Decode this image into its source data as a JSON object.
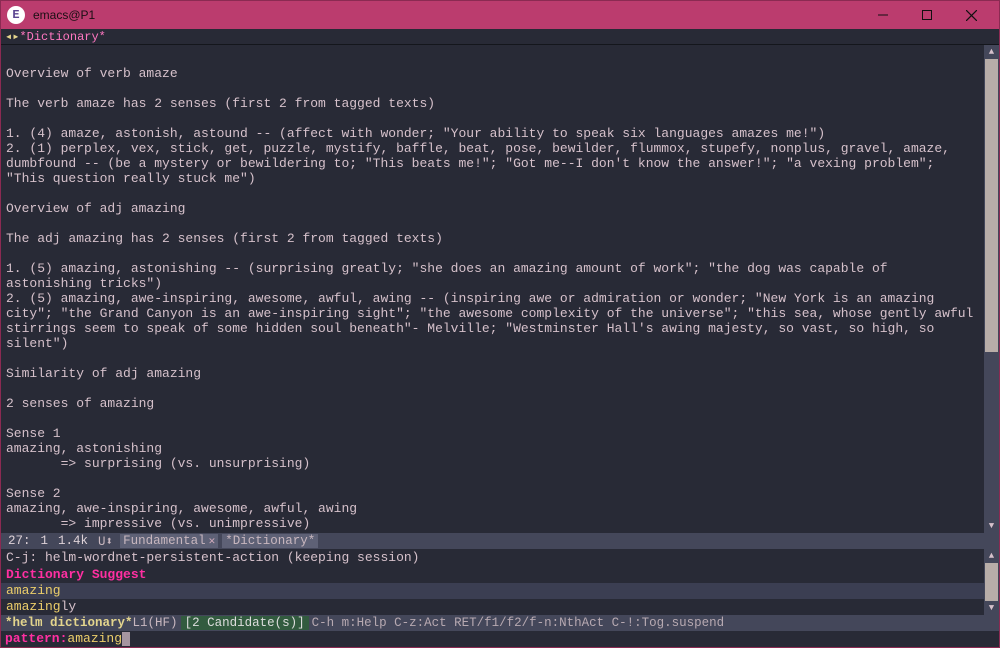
{
  "window": {
    "title": "emacs@P1"
  },
  "buffer_tab": {
    "marker": "◂▸",
    "name": "*Dictionary*"
  },
  "dictionary_text": "\nOverview of verb amaze\n\nThe verb amaze has 2 senses (first 2 from tagged texts)\n\n1. (4) amaze, astonish, astound -- (affect with wonder; \"Your ability to speak six languages amazes me!\")\n2. (1) perplex, vex, stick, get, puzzle, mystify, baffle, beat, pose, bewilder, flummox, stupefy, nonplus, gravel, amaze, dumbfound -- (be a mystery or bewildering to; \"This beats me!\"; \"Got me--I don't know the answer!\"; \"a vexing problem\"; \"This question really stuck me\")\n\nOverview of adj amazing\n\nThe adj amazing has 2 senses (first 2 from tagged texts)\n\n1. (5) amazing, astonishing -- (surprising greatly; \"she does an amazing amount of work\"; \"the dog was capable of astonishing tricks\")\n2. (5) amazing, awe-inspiring, awesome, awful, awing -- (inspiring awe or admiration or wonder; \"New York is an amazing city\"; \"the Grand Canyon is an awe-inspiring sight\"; \"the awesome complexity of the universe\"; \"this sea, whose gently awful stirrings seem to speak of some hidden soul beneath\"- Melville; \"Westminster Hall's awing majesty, so vast, so high, so silent\")\n\nSimilarity of adj amazing\n\n2 senses of amazing\n\nSense 1\namazing, astonishing\n       => surprising (vs. unsurprising)\n\nSense 2\namazing, awe-inspiring, awesome, awful, awing\n       => impressive (vs. unimpressive)\n",
  "modeline1": {
    "line": "27:",
    "col": "1",
    "size": "1.4k",
    "flag": "U⬍",
    "mode": "Fundamental",
    "buffer": "*Dictionary*"
  },
  "helm": {
    "action_hint": "C-j: helm-wordnet-persistent-action (keeping session)",
    "header": "Dictionary Suggest",
    "candidates": [
      {
        "match": "amazing",
        "rest": ""
      },
      {
        "match": "amazing",
        "rest": "ly"
      }
    ]
  },
  "modeline2": {
    "name": "*helm dictionary*",
    "pos": "L1",
    "enc": "(HF)",
    "candidates": "[2 Candidate(s)]",
    "hints": "C-h m:Help C-z:Act RET/f1/f2/f-n:NthAct C-!:Tog.suspend"
  },
  "minibuffer": {
    "prompt": "pattern: ",
    "value": "amazing"
  }
}
